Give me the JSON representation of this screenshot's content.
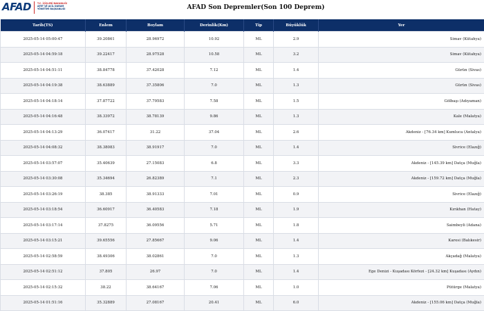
{
  "header": {
    "logo_text": "AFAD",
    "logo_sub": [
      "T.C. İÇİŞLERİ BAKANLIĞI",
      "AFET VE ACİL DURUM",
      "YÖNETİMİ BAŞKANLIĞI"
    ],
    "title": "AFAD Son Depremler(Son 100 Deprem)"
  },
  "table": {
    "columns": [
      "Tarih(TS)",
      "Enlem",
      "Boylam",
      "Derinlik(Km)",
      "Tip",
      "Büyüklük",
      "Yer"
    ],
    "rows": [
      [
        "2025-05-14 05:00:47",
        "39.20861",
        "28.96972",
        "10.92",
        "ML",
        "2.9",
        "Simav (Kütahya)"
      ],
      [
        "2025-05-14 04:59:18",
        "39.22417",
        "28.97528",
        "10.58",
        "ML",
        "3.2",
        "Simav (Kütahya)"
      ],
      [
        "2025-05-14 04:51:11",
        "38.84778",
        "37.42028",
        "7.12",
        "ML",
        "1.4",
        "Gürün (Sivas)"
      ],
      [
        "2025-05-14 04:19:38",
        "38.63889",
        "37.35806",
        "7.0",
        "ML",
        "1.3",
        "Gürün (Sivas)"
      ],
      [
        "2025-05-14 04:18:14",
        "37.87722",
        "37.79583",
        "7.58",
        "ML",
        "1.5",
        "Gölbaşı (Adıyaman)"
      ],
      [
        "2025-05-14 04:16:48",
        "38.33972",
        "38.78139",
        "9.86",
        "ML",
        "1.3",
        "Kale (Malatya)"
      ],
      [
        "2025-05-14 04:13:29",
        "36.07417",
        "31.22",
        "37.04",
        "ML",
        "2.6",
        "Akdeniz - [76.34 km] Kumluca (Antalya)"
      ],
      [
        "2025-05-14 04:08:32",
        "38.38083",
        "38.91917",
        "7.0",
        "ML",
        "1.4",
        "Sivrice (Elazığ)"
      ],
      [
        "2025-05-14 03:57:07",
        "35.40639",
        "27.15083",
        "6.8",
        "ML",
        "3.3",
        "Akdeniz - [145.39 km] Datça (Muğla)"
      ],
      [
        "2025-05-14 03:30:08",
        "35.34694",
        "26.82389",
        "7.1",
        "ML",
        "2.3",
        "Akdeniz - [159.72 km] Datça (Muğla)"
      ],
      [
        "2025-05-14 03:26:19",
        "38.385",
        "38.91333",
        "7.01",
        "ML",
        "0.9",
        "Sivrice (Elazığ)"
      ],
      [
        "2025-05-14 03:18:54",
        "36.60917",
        "36.40583",
        "7.18",
        "ML",
        "1.9",
        "Kırıkhan (Hatay)"
      ],
      [
        "2025-05-14 03:17:14",
        "37.8275",
        "36.09556",
        "5.71",
        "ML",
        "1.8",
        "Saimbeyli (Adana)"
      ],
      [
        "2025-05-14 03:15:21",
        "39.65556",
        "27.85667",
        "9.06",
        "ML",
        "1.4",
        "Karesi (Balıkesir)"
      ],
      [
        "2025-05-14 02:58:59",
        "38.49306",
        "38.02861",
        "7.0",
        "ML",
        "1.3",
        "Akçadağ (Malatya)"
      ],
      [
        "2025-05-14 02:51:12",
        "37.805",
        "26.97",
        "7.0",
        "ML",
        "1.4",
        "Ege Denizi - Kuşadası Körfezi - [24.32 km] Kuşadası (Aydın)"
      ],
      [
        "2025-05-14 02:15:32",
        "38.22",
        "38.64167",
        "7.06",
        "ML",
        "1.0",
        "Pütürge (Malatya)"
      ],
      [
        "2025-05-14 01:51:16",
        "35.32889",
        "27.08167",
        "20.41",
        "ML",
        "6.0",
        "Akdeniz - [155.06 km] Datça (Muğla)"
      ]
    ]
  }
}
